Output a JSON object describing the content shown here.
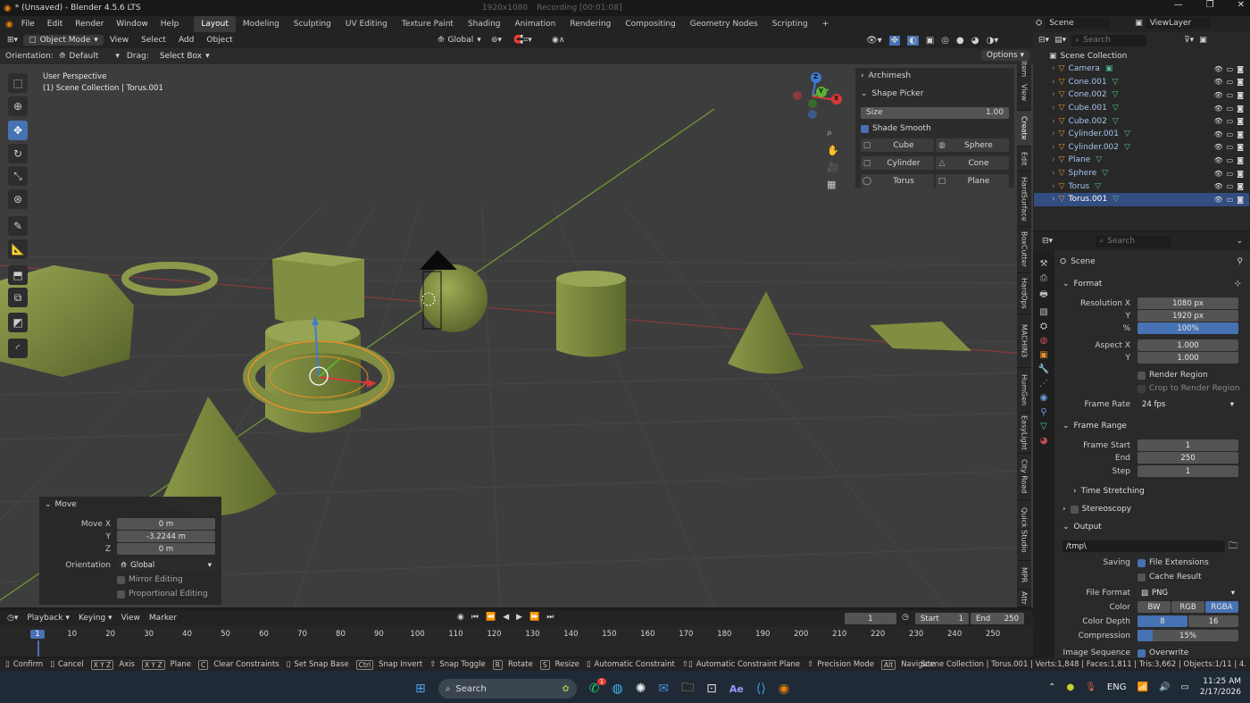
{
  "titlebar": {
    "title": "* (Unsaved) - Blender 4.5.6 LTS",
    "resolution": "1920x1080",
    "recording": "Recording [00:01:08]"
  },
  "menu": {
    "items": [
      "File",
      "Edit",
      "Render",
      "Window",
      "Help"
    ]
  },
  "workspaces": [
    "Layout",
    "Modeling",
    "Sculpting",
    "UV Editing",
    "Texture Paint",
    "Shading",
    "Animation",
    "Rendering",
    "Compositing",
    "Geometry Nodes",
    "Scripting"
  ],
  "add_workspace": "+",
  "scene": {
    "name": "Scene",
    "viewlayer": "ViewLayer"
  },
  "viewport_header": {
    "mode": "Object Mode",
    "menus": [
      "View",
      "Select",
      "Add",
      "Object"
    ],
    "transform": "Global"
  },
  "toolsettings": {
    "orientation_label": "Orientation:",
    "orientation": "Default",
    "drag_label": "Drag:",
    "drag": "Select Box",
    "options": "Options"
  },
  "overlay": {
    "line1": "User Perspective",
    "line2": "(1) Scene Collection | Torus.001"
  },
  "npanel": {
    "archimesh": "Archimesh",
    "shape_picker": "Shape Picker",
    "size_label": "Size",
    "size": "1.00",
    "shade_smooth": "Shade Smooth",
    "shapes": [
      "Cube",
      "Sphere",
      "Cylinder",
      "Cone",
      "Torus",
      "Plane"
    ]
  },
  "sidetabs": [
    "Item",
    "View",
    "Create",
    "Edit",
    "HardSurface",
    "BoxCutter",
    "HardOps",
    "MACHIN3",
    "HumGen",
    "EasyLight",
    "City Road",
    "Quick Studio",
    "MPR",
    "Attr"
  ],
  "gizmo_axes": [
    "Z",
    "Y",
    "X"
  ],
  "move_panel": {
    "title": "Move",
    "x_label": "Move X",
    "x": "0 m",
    "y_label": "Y",
    "y": "-3.2244 m",
    "z_label": "Z",
    "z": "0 m",
    "orientation_label": "Orientation",
    "orientation": "Global",
    "mirror": "Mirror Editing",
    "proportional": "Proportional Editing"
  },
  "outliner": {
    "search_placeholder": "Search",
    "collection": "Scene Collection",
    "items": [
      "Camera",
      "Cone.001",
      "Cone.002",
      "Cube.001",
      "Cube.002",
      "Cylinder.001",
      "Cylinder.002",
      "Plane",
      "Sphere",
      "Torus",
      "Torus.001"
    ]
  },
  "properties": {
    "search_placeholder": "Search",
    "scene": "Scene",
    "format": "Format",
    "res_x_label": "Resolution X",
    "res_x": "1080 px",
    "res_y_label": "Y",
    "res_y": "1920 px",
    "pct_label": "%",
    "pct": "100%",
    "aspect_x_label": "Aspect X",
    "aspect_x": "1.000",
    "aspect_y_label": "Y",
    "aspect_y": "1.000",
    "render_region": "Render Region",
    "crop": "Crop to Render Region",
    "frame_rate_label": "Frame Rate",
    "frame_rate": "24 fps",
    "frame_range": "Frame Range",
    "frame_start_label": "Frame Start",
    "frame_start": "1",
    "end_label": "End",
    "end": "250",
    "step_label": "Step",
    "step": "1",
    "time_stretching": "Time Stretching",
    "stereoscopy": "Stereoscopy",
    "output": "Output",
    "path": "/tmp\\",
    "saving_label": "Saving",
    "file_ext": "File Extensions",
    "cache": "Cache Result",
    "file_format_label": "File Format",
    "file_format": "PNG",
    "color_label": "Color",
    "color_opts": [
      "BW",
      "RGB",
      "RGBA"
    ],
    "depth_label": "Color Depth",
    "depth_opts": [
      "8",
      "16"
    ],
    "compression_label": "Compression",
    "compression": "15%",
    "compression_value": 0.15,
    "image_seq_label": "Image Sequence",
    "overwrite": "Overwrite"
  },
  "timeline": {
    "playback": "Playback",
    "keying": "Keying",
    "view": "View",
    "marker": "Marker",
    "current": "1",
    "start_label": "Start",
    "start": "1",
    "end_label": "End",
    "end": "250",
    "ticks": [
      "1",
      "10",
      "20",
      "30",
      "40",
      "50",
      "60",
      "70",
      "80",
      "90",
      "100",
      "110",
      "120",
      "130",
      "140",
      "150",
      "160",
      "170",
      "180",
      "190",
      "200",
      "210",
      "220",
      "230",
      "240",
      "250"
    ]
  },
  "statusbar": {
    "items": [
      "Confirm",
      "Cancel",
      "Axis",
      "Plane",
      "Clear Constraints",
      "Set Snap Base",
      "Snap Invert",
      "Snap Toggle",
      "Rotate",
      "Resize",
      "Automatic Constraint",
      "Automatic Constraint Plane",
      "Precision Mode",
      "Navigate"
    ],
    "keys": [
      "X Y Z",
      "X Y Z",
      "C",
      "Ctrl",
      "R",
      "S",
      "Alt"
    ],
    "stats": "Scene Collection | Torus.001 | Verts:1,848 | Faces:1,811 | Tris:3,662 | Objects:1/11 | 4."
  },
  "taskbar": {
    "search": "Search",
    "lang": "ENG",
    "time": "11:25 AM",
    "date": "2/17/2026",
    "badge": "1"
  },
  "colors": {
    "accent": "#4772b3",
    "object_green": "#7b8a3e",
    "selection_orange": "#e8902c"
  }
}
